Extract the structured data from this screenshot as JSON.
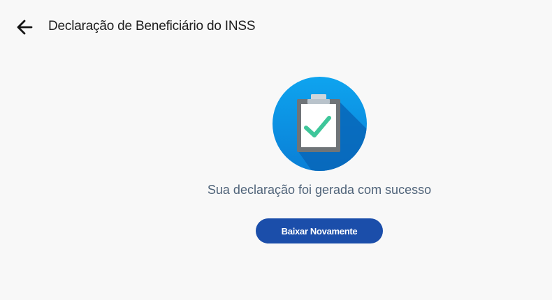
{
  "header": {
    "title": "Declaração de Beneficiário do INSS",
    "back_icon": "arrow-left-icon"
  },
  "main": {
    "illustration_icon": "clipboard-check-icon",
    "message": "Sua declaração foi gerada com sucesso",
    "download_again_label": "Baixar Novamente"
  },
  "colors": {
    "page_background": "#f8f8f8",
    "primary_button": "#1b4eaa",
    "circle_blue": "#0a8fe0",
    "check_green": "#3ec69a",
    "message_text": "#4f6379"
  }
}
